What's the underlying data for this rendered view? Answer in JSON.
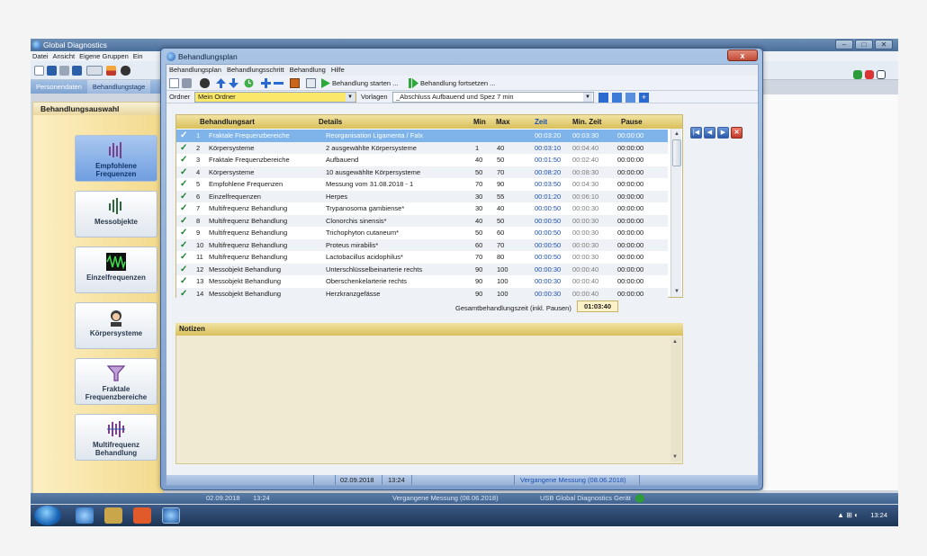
{
  "main_window": {
    "title": "Global Diagnostics",
    "menu": [
      "Datei",
      "Ansicht",
      "Eigene Gruppen",
      "Ein"
    ],
    "tabs": [
      "Personendaten",
      "Behandlungstage"
    ],
    "left_panel_title": "Behandlungsauswahl",
    "nav_buttons": [
      {
        "label": "Empfohlene Frequenzen",
        "icon": "frequency-bars-icon"
      },
      {
        "label": "Messobjekte",
        "icon": "wave-bars-icon"
      },
      {
        "label": "Einzelfrequenzen",
        "icon": "waveform-icon"
      },
      {
        "label": "Körpersysteme",
        "icon": "person-icon"
      },
      {
        "label": "Fraktale Frequenzbereiche",
        "icon": "funnel-icon"
      },
      {
        "label": "Multifrequenz Behandlung",
        "icon": "multifrequency-icon"
      }
    ],
    "status": {
      "date": "02.09.2018",
      "time": "13:24",
      "measurement": "Vergangene Messung (08.06.2018)",
      "device": "USB Global Diagnostics Gerät"
    }
  },
  "taskbar": {
    "clock": "13:24",
    "tray": "▲  ⊞  ◐"
  },
  "dialog": {
    "title": "Behandlungsplan",
    "close_label": "x",
    "menu": [
      "Behandlungsplan",
      "Behandlungsschritt",
      "Behandlung",
      "Hilfe"
    ],
    "start_label": "Behandlung starten ...",
    "continue_label": "Behandlung fortsetzen ...",
    "ordner_label": "Ordner",
    "ordner_value": "Mein Ordner",
    "vorlagen_label": "Vorlagen",
    "vorlagen_value": "_Abschluss Aufbauend und Spez 7 min",
    "columns": {
      "art": "Behandlungsart",
      "details": "Details",
      "min": "Min",
      "max": "Max",
      "zeit": "Zeit",
      "minzeit": "Min. Zeit",
      "pause": "Pause"
    },
    "rows": [
      {
        "n": "1",
        "art": "Fraktale Frequenzbereiche",
        "details": "Reorganisation Ligamenta / Falx",
        "min": "",
        "max": "",
        "zeit": "00:03:20",
        "minzeit": "00:03:30",
        "pause": "00:00:00"
      },
      {
        "n": "2",
        "art": "Körpersysteme",
        "details": "2 ausgewählte Körpersysteme",
        "min": "1",
        "max": "40",
        "zeit": "00:03:10",
        "minzeit": "00:04:40",
        "pause": "00:00:00"
      },
      {
        "n": "3",
        "art": "Fraktale Frequenzbereiche",
        "details": "Aufbauend",
        "min": "40",
        "max": "50",
        "zeit": "00:01:50",
        "minzeit": "00:02:40",
        "pause": "00:00:00"
      },
      {
        "n": "4",
        "art": "Körpersysteme",
        "details": "10 ausgewählte Körpersysteme",
        "min": "50",
        "max": "70",
        "zeit": "00:08:20",
        "minzeit": "00:08:30",
        "pause": "00:00:00"
      },
      {
        "n": "5",
        "art": "Empfohlene Frequenzen",
        "details": "Messung vom 31.08.2018 - 1",
        "min": "70",
        "max": "90",
        "zeit": "00:03:50",
        "minzeit": "00:04:30",
        "pause": "00:00:00"
      },
      {
        "n": "6",
        "art": "Einzelfrequenzen",
        "details": "Herpes",
        "min": "30",
        "max": "55",
        "zeit": "00:01:20",
        "minzeit": "00:06:10",
        "pause": "00:00:00"
      },
      {
        "n": "7",
        "art": "Multifrequenz Behandlung",
        "details": "Trypanosoma gambiense*",
        "min": "30",
        "max": "40",
        "zeit": "00:00:50",
        "minzeit": "00:00:30",
        "pause": "00:00:00"
      },
      {
        "n": "8",
        "art": "Multifrequenz Behandlung",
        "details": "Clonorchis sinensis*",
        "min": "40",
        "max": "50",
        "zeit": "00:00:50",
        "minzeit": "00:00:30",
        "pause": "00:00:00"
      },
      {
        "n": "9",
        "art": "Multifrequenz Behandlung",
        "details": "Trichophyton cutaneum*",
        "min": "50",
        "max": "60",
        "zeit": "00:00:50",
        "minzeit": "00:00:30",
        "pause": "00:00:00"
      },
      {
        "n": "10",
        "art": "Multifrequenz Behandlung",
        "details": "Proteus mirabilis*",
        "min": "60",
        "max": "70",
        "zeit": "00:00:50",
        "minzeit": "00:00:30",
        "pause": "00:00:00"
      },
      {
        "n": "11",
        "art": "Multifrequenz Behandlung",
        "details": "Lactobacillus acidophilus*",
        "min": "70",
        "max": "80",
        "zeit": "00:00:50",
        "minzeit": "00:00:30",
        "pause": "00:00:00"
      },
      {
        "n": "12",
        "art": "Messobjekt Behandlung",
        "details": "Unterschlüsselbeinarterie rechts",
        "min": "90",
        "max": "100",
        "zeit": "00:00:30",
        "minzeit": "00:00:40",
        "pause": "00:00:00"
      },
      {
        "n": "13",
        "art": "Messobjekt Behandlung",
        "details": "Oberschenkelarterie rechts",
        "min": "90",
        "max": "100",
        "zeit": "00:00:30",
        "minzeit": "00:00:40",
        "pause": "00:00:00"
      },
      {
        "n": "14",
        "art": "Messobjekt Behandlung",
        "details": "Herzkranzgefässe",
        "min": "90",
        "max": "100",
        "zeit": "00:00:30",
        "minzeit": "00:00:40",
        "pause": "00:00:00"
      }
    ],
    "total_label": "Gesamtbehandlungszeit (inkl. Pausen)",
    "total_value": "01:03:40",
    "notes_title": "Notizen",
    "status": {
      "date": "02.09.2018",
      "time": "13:24",
      "measurement": "Vergangene Messung (08.06.2018)"
    }
  },
  "colors": {
    "accent": "#2a5aa8",
    "check": "#1b7f2f",
    "time_blue": "#1d4fb0",
    "header_gold": "#d9bf5c"
  }
}
